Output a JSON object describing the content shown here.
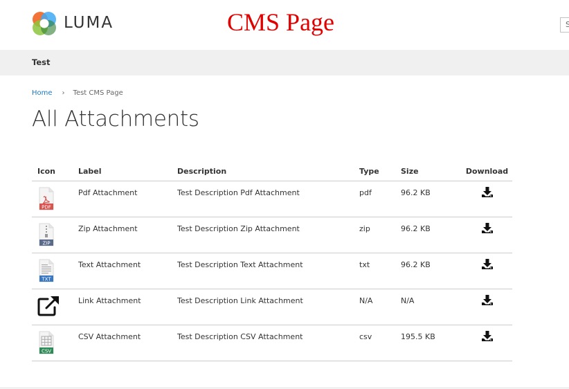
{
  "header": {
    "logo_text": "LUMA",
    "cms_title": "CMS Page",
    "search_placeholder": "S"
  },
  "nav": {
    "items": [
      {
        "label": "Test"
      }
    ]
  },
  "breadcrumb": {
    "home": "Home",
    "current": "Test CMS Page"
  },
  "page_title": "All Attachments",
  "table": {
    "headers": [
      "Icon",
      "Label",
      "Description",
      "Type",
      "Size",
      "Download"
    ],
    "rows": [
      {
        "icon": "pdf-file-icon",
        "icon_label": "PDF",
        "label": "Pdf Attachment",
        "description": "Test Description Pdf Attachment",
        "type": "pdf",
        "size": "96.2 KB"
      },
      {
        "icon": "zip-file-icon",
        "icon_label": "ZIP",
        "label": "Zip Attachment",
        "description": "Test Description Zip Attachment",
        "type": "zip",
        "size": "96.2 KB"
      },
      {
        "icon": "txt-file-icon",
        "icon_label": "TXT",
        "label": "Text Attachment",
        "description": "Test Description Text Attachment",
        "type": "txt",
        "size": "96.2 KB"
      },
      {
        "icon": "external-link-icon",
        "icon_label": "",
        "label": "Link Attachment",
        "description": "Test Description Link Attachment",
        "type": "N/A",
        "size": "N/A"
      },
      {
        "icon": "csv-file-icon",
        "icon_label": "CSV",
        "label": "CSV Attachment",
        "description": "Test Description CSV Attachment",
        "type": "csv",
        "size": "195.5 KB"
      }
    ]
  },
  "colors": {
    "cms_title": "#e00000",
    "link": "#1979c3",
    "nav_bg": "#f0f0f0"
  }
}
